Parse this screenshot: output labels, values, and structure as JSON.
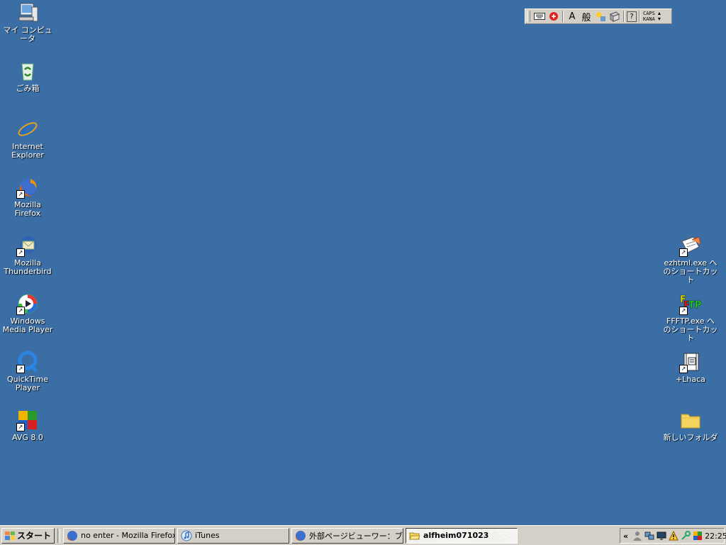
{
  "desktop": {
    "left_icons": [
      {
        "label": "マイ コンピュータ",
        "icon": "my-computer-icon"
      },
      {
        "label": "ごみ箱",
        "icon": "recycle-bin-icon"
      },
      {
        "label": "Internet\nExplorer",
        "icon": "internet-explorer-icon"
      },
      {
        "label": "Mozilla\nFirefox",
        "icon": "firefox-icon"
      },
      {
        "label": "Mozilla\nThunderbird",
        "icon": "thunderbird-icon"
      },
      {
        "label": "Windows\nMedia Player",
        "icon": "windows-media-player-icon"
      },
      {
        "label": "QuickTime\nPlayer",
        "icon": "quicktime-icon"
      },
      {
        "label": "AVG 8.0",
        "icon": "avg-icon"
      }
    ],
    "right_icons": [
      {
        "label": "ezhtml.exe へ\nのショートカット",
        "icon": "ezhtml-icon"
      },
      {
        "label": "FFFTP.exe へ\nのショートカット",
        "icon": "ffftp-icon"
      },
      {
        "label": "+Lhaca",
        "icon": "lhaca-icon"
      },
      {
        "label": "新しいフォルダ",
        "icon": "folder-icon"
      }
    ]
  },
  "langbar": {
    "input_mode": "A",
    "conversion_mode": "般",
    "help": "?",
    "caps": "CAPS",
    "kana": "KANA"
  },
  "taskbar": {
    "start_label": "スタート",
    "tasks": [
      {
        "label": "no enter - Mozilla Firefox",
        "icon": "firefox-icon",
        "active": false
      },
      {
        "label": "iTunes",
        "icon": "itunes-icon",
        "active": false
      },
      {
        "label": "外部ページビューワー：ブッ...",
        "icon": "firefox-icon",
        "active": false
      },
      {
        "label": "alfheim071023",
        "icon": "folder-open-icon",
        "active": true
      }
    ],
    "tray": {
      "expand": "«",
      "clock": "22:25"
    }
  },
  "colors": {
    "desktop": "#3a6ea5",
    "taskbar": "#d4d0c8"
  }
}
